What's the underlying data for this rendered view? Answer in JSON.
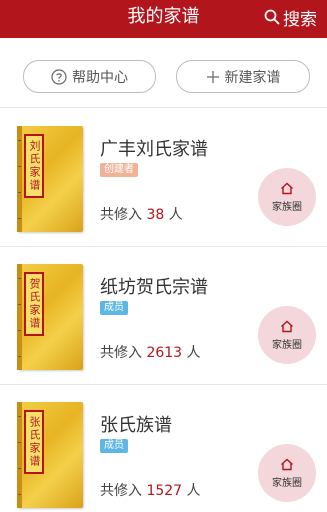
{
  "header": {
    "title": "我的家谱",
    "search_label": "搜索"
  },
  "actions": {
    "help_label": "帮助中心",
    "create_label": "新建家谱"
  },
  "genealogies": [
    {
      "book_title": "刘氏家谱",
      "name": "广丰刘氏家谱",
      "role": "创建者",
      "count_prefix": "共修入",
      "count": "38",
      "count_suffix": "人",
      "circle_label": "家族圈"
    },
    {
      "book_title": "贺氏家谱",
      "name": "纸坊贺氏宗谱",
      "role": "成员",
      "count_prefix": "共修入",
      "count": "2613",
      "count_suffix": "人",
      "circle_label": "家族圈"
    },
    {
      "book_title": "张氏家谱",
      "name": "张氏族谱",
      "role": "成员",
      "count_prefix": "共修入",
      "count": "1527",
      "count_suffix": "人",
      "circle_label": "家族圈"
    }
  ],
  "colors": {
    "brand": "#b3151d",
    "creator_tag": "#f0b398",
    "member_tag": "#5db6e6",
    "circle_bg": "#f3d7da"
  }
}
